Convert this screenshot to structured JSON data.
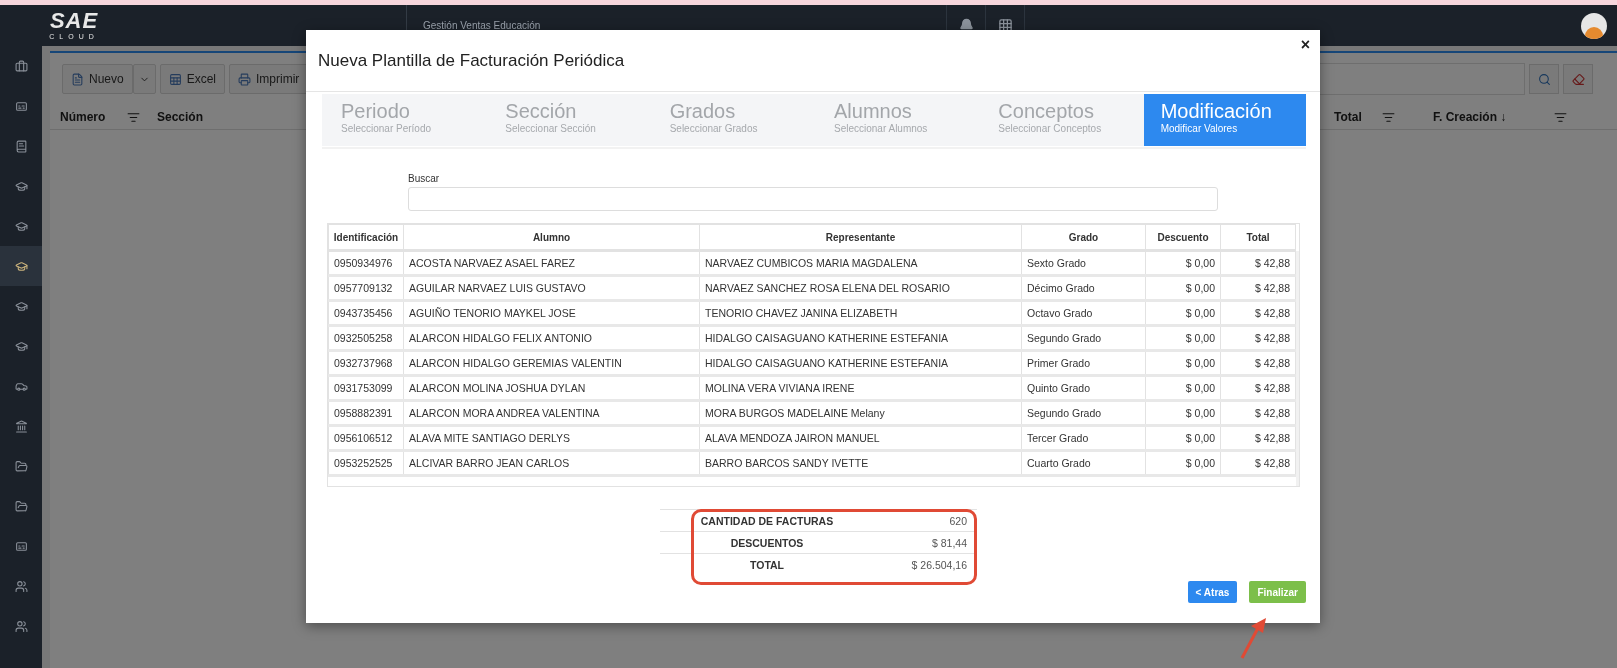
{
  "topbar": {
    "logo": {
      "mark": "SAE",
      "sub": "CLOUD"
    },
    "module": "Gestión Ventas Educación"
  },
  "sidebar": {
    "items": [
      {
        "selected": false
      },
      {
        "selected": false
      },
      {
        "selected": false
      },
      {
        "selected": false
      },
      {
        "selected": false
      },
      {
        "selected": true
      },
      {
        "selected": false
      },
      {
        "selected": false
      },
      {
        "selected": false
      },
      {
        "selected": false
      },
      {
        "selected": false
      },
      {
        "selected": false
      },
      {
        "selected": false
      },
      {
        "selected": false
      },
      {
        "selected": false
      }
    ]
  },
  "toolbar": {
    "buttons": [
      "Nuevo",
      "Excel",
      "Imprimir"
    ]
  },
  "list": {
    "columns": [
      {
        "label": "Número"
      },
      {
        "label": "Sección"
      },
      {
        "label": "Total"
      },
      {
        "label": "F. Creación ↓"
      }
    ]
  },
  "modal": {
    "title": "Nueva Plantilla de Facturación Periódica",
    "close": "×",
    "steps": [
      {
        "title": "Periodo",
        "subtitle": "Seleccionar Período",
        "selected": false
      },
      {
        "title": "Sección",
        "subtitle": "Seleccionar Sección",
        "selected": false
      },
      {
        "title": "Grados",
        "subtitle": "Seleccionar Grados",
        "selected": false
      },
      {
        "title": "Alumnos",
        "subtitle": "Seleccionar Alumnos",
        "selected": false
      },
      {
        "title": "Conceptos",
        "subtitle": "Seleccionar Conceptos",
        "selected": false
      },
      {
        "title": "Modificación",
        "subtitle": "Modificar Valores",
        "selected": true
      }
    ],
    "search": {
      "label": "Buscar"
    },
    "table": {
      "columns": [
        "Identificación",
        "Alumno",
        "Representante",
        "Grado",
        "Descuento",
        "Total"
      ],
      "rows": [
        [
          "0950934976",
          "ACOSTA NARVAEZ ASAEL FAREZ",
          "NARVAEZ CUMBICOS MARIA MAGDALENA",
          "Sexto Grado",
          "$ 0,00",
          "$ 42,88"
        ],
        [
          "0957709132",
          "AGUILAR NARVAEZ LUIS GUSTAVO",
          "NARVAEZ SANCHEZ ROSA ELENA DEL ROSARIO",
          "Décimo Grado",
          "$ 0,00",
          "$ 42,88"
        ],
        [
          "0943735456",
          "AGUIÑO TENORIO MAYKEL JOSE",
          "TENORIO CHAVEZ JANINA ELIZABETH",
          "Octavo Grado",
          "$ 0,00",
          "$ 42,88"
        ],
        [
          "0932505258",
          "ALARCON HIDALGO FELIX ANTONIO",
          "HIDALGO CAISAGUANO KATHERINE ESTEFANIA",
          "Segundo Grado",
          "$ 0,00",
          "$ 42,88"
        ],
        [
          "0932737968",
          "ALARCON HIDALGO GEREMIAS VALENTIN",
          "HIDALGO CAISAGUANO KATHERINE ESTEFANIA",
          "Primer Grado",
          "$ 0,00",
          "$ 42,88"
        ],
        [
          "0931753099",
          "ALARCON MOLINA JOSHUA DYLAN",
          "MOLINA VERA VIVIANA IRENE",
          "Quinto Grado",
          "$ 0,00",
          "$ 42,88"
        ],
        [
          "0958882391",
          "ALARCON MORA ANDREA VALENTINA",
          "MORA BURGOS MADELAINE Melany",
          "Segundo Grado",
          "$ 0,00",
          "$ 42,88"
        ],
        [
          "0956106512",
          "ALAVA MITE SANTIAGO DERLYS",
          "ALAVA MENDOZA JAIRON MANUEL",
          "Tercer Grado",
          "$ 0,00",
          "$ 42,88"
        ],
        [
          "0953252525",
          "ALCIVAR BARRO JEAN CARLOS",
          "BARRO BARCOS SANDY IVETTE",
          "Cuarto Grado",
          "$ 0,00",
          "$ 42,88"
        ]
      ]
    },
    "summary": [
      {
        "label": "CANTIDAD DE FACTURAS",
        "value": "620"
      },
      {
        "label": "DESCUENTOS",
        "value": "$ 81,44"
      },
      {
        "label": "TOTAL",
        "value": "$ 26.504,16"
      }
    ],
    "back": "< Atras",
    "finish": "Finalizar"
  }
}
